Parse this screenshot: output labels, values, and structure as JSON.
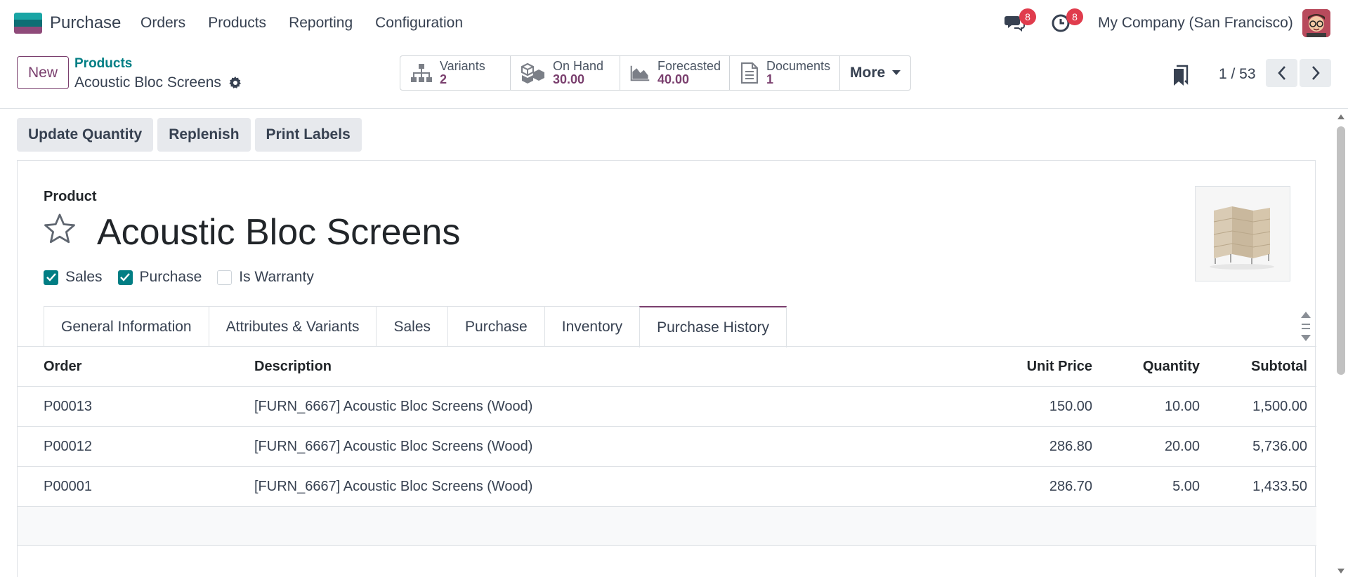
{
  "nav": {
    "app_name": "Purchase",
    "menu": [
      "Orders",
      "Products",
      "Reporting",
      "Configuration"
    ],
    "messages_count": "8",
    "activities_count": "8",
    "company": "My Company (San Francisco)"
  },
  "control": {
    "new_label": "New",
    "breadcrumb": "Products",
    "record_name": "Acoustic Bloc Screens",
    "smart_buttons": [
      {
        "icon": "variants-icon",
        "label": "Variants",
        "value": "2"
      },
      {
        "icon": "boxes-icon",
        "label": "On Hand",
        "value": "30.00"
      },
      {
        "icon": "area-chart-icon",
        "label": "Forecasted",
        "value": "40.00"
      },
      {
        "icon": "document-icon",
        "label": "Documents",
        "value": "1"
      }
    ],
    "more_label": "More",
    "pager": "1 / 53"
  },
  "actions": [
    "Update Quantity",
    "Replenish",
    "Print Labels"
  ],
  "form": {
    "product_label": "Product",
    "product_name": "Acoustic Bloc Screens",
    "checkboxes": [
      {
        "label": "Sales",
        "checked": true
      },
      {
        "label": "Purchase",
        "checked": true
      },
      {
        "label": "Is Warranty",
        "checked": false
      }
    ],
    "tabs": [
      "General Information",
      "Attributes & Variants",
      "Sales",
      "Purchase",
      "Inventory",
      "Purchase History"
    ],
    "active_tab": "Purchase History"
  },
  "history": {
    "headers": {
      "order": "Order",
      "description": "Description",
      "unit_price": "Unit Price",
      "quantity": "Quantity",
      "subtotal": "Subtotal"
    },
    "rows": [
      {
        "order": "P00013",
        "description": "[FURN_6667] Acoustic Bloc Screens (Wood)",
        "unit_price": "150.00",
        "quantity": "10.00",
        "subtotal": "1,500.00"
      },
      {
        "order": "P00012",
        "description": "[FURN_6667] Acoustic Bloc Screens (Wood)",
        "unit_price": "286.80",
        "quantity": "20.00",
        "subtotal": "5,736.00"
      },
      {
        "order": "P00001",
        "description": "[FURN_6667] Acoustic Bloc Screens (Wood)",
        "unit_price": "286.70",
        "quantity": "5.00",
        "subtotal": "1,433.50"
      }
    ]
  },
  "colors": {
    "brand": "#7a3f6e",
    "teal": "#017e84",
    "badge": "#e03c4d"
  }
}
